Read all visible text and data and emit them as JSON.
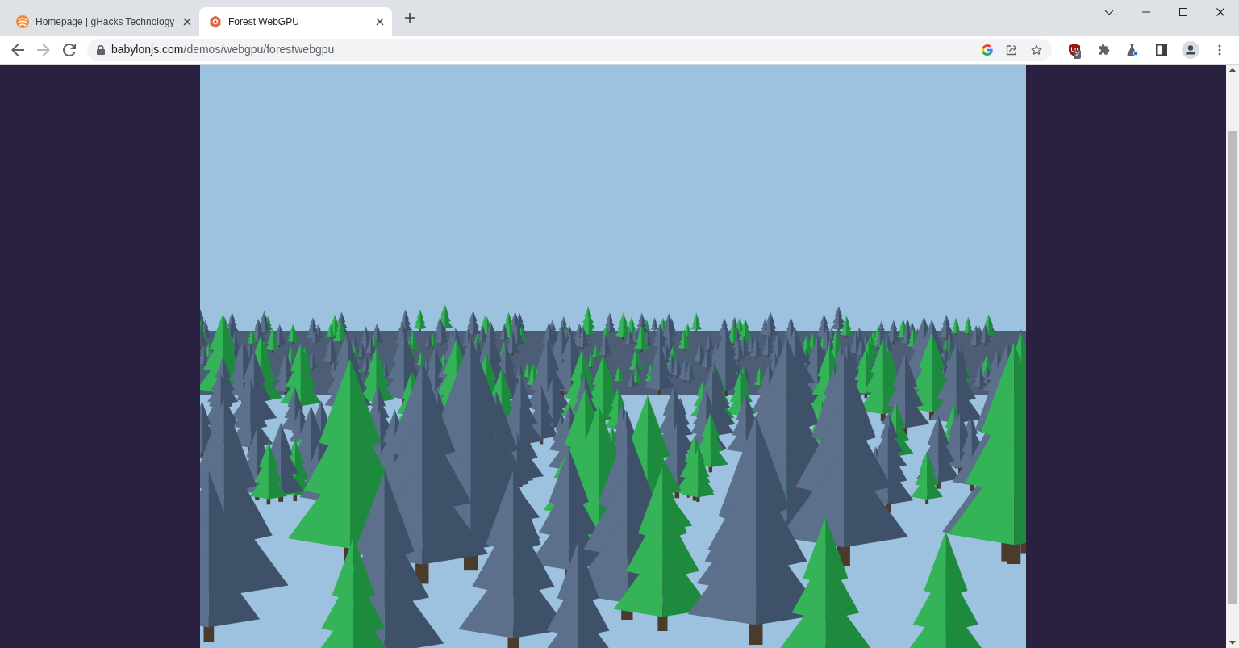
{
  "window": {
    "tabs": [
      {
        "title": "Homepage | gHacks Technology",
        "kind": "swirl",
        "selected": false
      },
      {
        "title": "Forest WebGPU",
        "kind": "hexagon",
        "selected": true
      }
    ]
  },
  "nav_buttons": [
    {
      "kind": "back",
      "disabled": false
    },
    {
      "kind": "forward",
      "disabled": true
    },
    {
      "kind": "reload",
      "disabled": false
    }
  ],
  "address_bar": {
    "url": "babylonjs.com/demos/webgpu/forestwebgpu"
  },
  "toolbar_icons": [
    {
      "kind": "shield",
      "badge": "2"
    },
    {
      "kind": "puzzle"
    },
    {
      "kind": "flask"
    },
    {
      "kind": "side-panel"
    },
    {
      "kind": "avatar"
    },
    {
      "kind": "menu"
    }
  ]
}
